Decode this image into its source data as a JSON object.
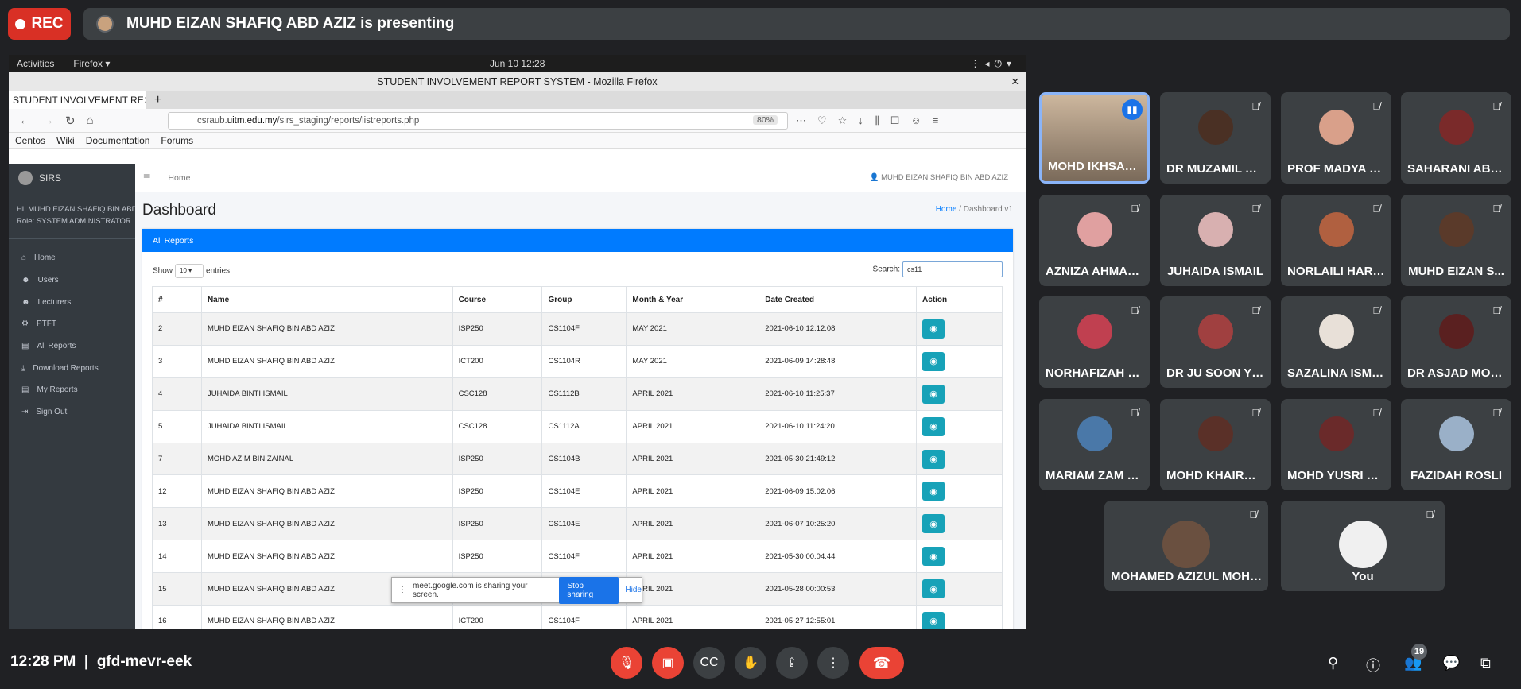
{
  "meet": {
    "rec_label": "REC",
    "presenting_text": "MUHD EIZAN SHAFIQ ABD AZIZ is presenting",
    "time": "12:28 PM",
    "meeting_code": "gfd-mevr-eek",
    "participant_count": "19"
  },
  "gnome": {
    "activities": "Activities",
    "app": "Firefox ▾",
    "clock": "Jun 10  12:28"
  },
  "firefox": {
    "window_title": "STUDENT INVOLVEMENT REPORT SYSTEM - Mozilla Firefox",
    "tab_title": "STUDENT INVOLVEMENT RE",
    "url_domain": "csraub.",
    "url_host": "uitm.edu.my",
    "url_path": "/sirs_staging/reports/listreports.php",
    "zoom": "80%",
    "bookmarks": [
      "Centos",
      "Wiki",
      "Documentation",
      "Forums"
    ]
  },
  "app": {
    "brand": "SIRS",
    "user_greeting": "Hi, MUHD EIZAN SHAFIQ BIN ABD A",
    "user_role": "Role: SYSTEM ADMINISTRATOR",
    "menu": [
      "Home",
      "Users",
      "Lecturers",
      "PTFT",
      "All Reports",
      "Download Reports",
      "My Reports",
      "Sign Out"
    ],
    "topnav_home": "Home",
    "topnav_user": "MUHD EIZAN SHAFIQ BIN ABD AZIZ",
    "page_title": "Dashboard",
    "breadcrumb_home": "Home",
    "breadcrumb_current": "Dashboard v1",
    "card_title": "All Reports",
    "show_label": "Show",
    "entries_value": "10",
    "entries_label": "entries",
    "search_label": "Search:",
    "search_value": "cs11",
    "columns": [
      "#",
      "Name",
      "Course",
      "Group",
      "Month & Year",
      "Date Created",
      "Action"
    ],
    "rows": [
      [
        "2",
        "MUHD EIZAN SHAFIQ BIN ABD AZIZ",
        "ISP250",
        "CS1104F",
        "MAY 2021",
        "2021-06-10 12:12:08"
      ],
      [
        "3",
        "MUHD EIZAN SHAFIQ BIN ABD AZIZ",
        "ICT200",
        "CS1104R",
        "MAY 2021",
        "2021-06-09 14:28:48"
      ],
      [
        "4",
        "JUHAIDA BINTI ISMAIL",
        "CSC128",
        "CS1112B",
        "APRIL 2021",
        "2021-06-10 11:25:37"
      ],
      [
        "5",
        "JUHAIDA BINTI ISMAIL",
        "CSC128",
        "CS1112A",
        "APRIL 2021",
        "2021-06-10 11:24:20"
      ],
      [
        "7",
        "MOHD AZIM BIN ZAINAL",
        "ISP250",
        "CS1104B",
        "APRIL 2021",
        "2021-05-30 21:49:12"
      ],
      [
        "12",
        "MUHD EIZAN SHAFIQ BIN ABD AZIZ",
        "ISP250",
        "CS1104E",
        "APRIL 2021",
        "2021-06-09 15:02:06"
      ],
      [
        "13",
        "MUHD EIZAN SHAFIQ BIN ABD AZIZ",
        "ISP250",
        "CS1104E",
        "APRIL 2021",
        "2021-06-07 10:25:20"
      ],
      [
        "14",
        "MUHD EIZAN SHAFIQ BIN ABD AZIZ",
        "ISP250",
        "CS1104F",
        "APRIL 2021",
        "2021-05-30 00:04:44"
      ],
      [
        "15",
        "MUHD EIZAN SHAFIQ BIN ABD AZIZ",
        "",
        "",
        "APRIL 2021",
        "2021-05-28 00:00:53"
      ],
      [
        "16",
        "MUHD EIZAN SHAFIQ BIN ABD AZIZ",
        "ICT200",
        "CS1104F",
        "APRIL 2021",
        "2021-05-27 12:55:01"
      ]
    ]
  },
  "share_notice": {
    "text": "meet.google.com is sharing your screen.",
    "stop": "Stop sharing",
    "hide": "Hide"
  },
  "participants": [
    "MOHD IKHSAN ...",
    "DR MUZAMIL M...",
    "PROF MADYA D...",
    "SAHARANI ABD...",
    "AZNIZA AHMAD...",
    "JUHAIDA ISMAIL",
    "NORLAILI HARUN",
    "MUHD EIZAN S...",
    "NORHAFIZAH R...",
    "DR JU SOON YE...",
    "SAZALINA ISMA...",
    "DR ASJAD MOH...",
    "MARIAM ZAM Z...",
    "MOHD KHAIRUL...",
    "MOHD YUSRI M...",
    "FAZIDAH ROSLI",
    "MOHAMED AZIZUL MOHA...",
    "You"
  ],
  "colors": {
    "meet_bg": "#202124",
    "tile_bg": "#3c4043",
    "accent_blue": "#007bff",
    "rec_red": "#d93025",
    "view_button": "#17a2b8"
  }
}
